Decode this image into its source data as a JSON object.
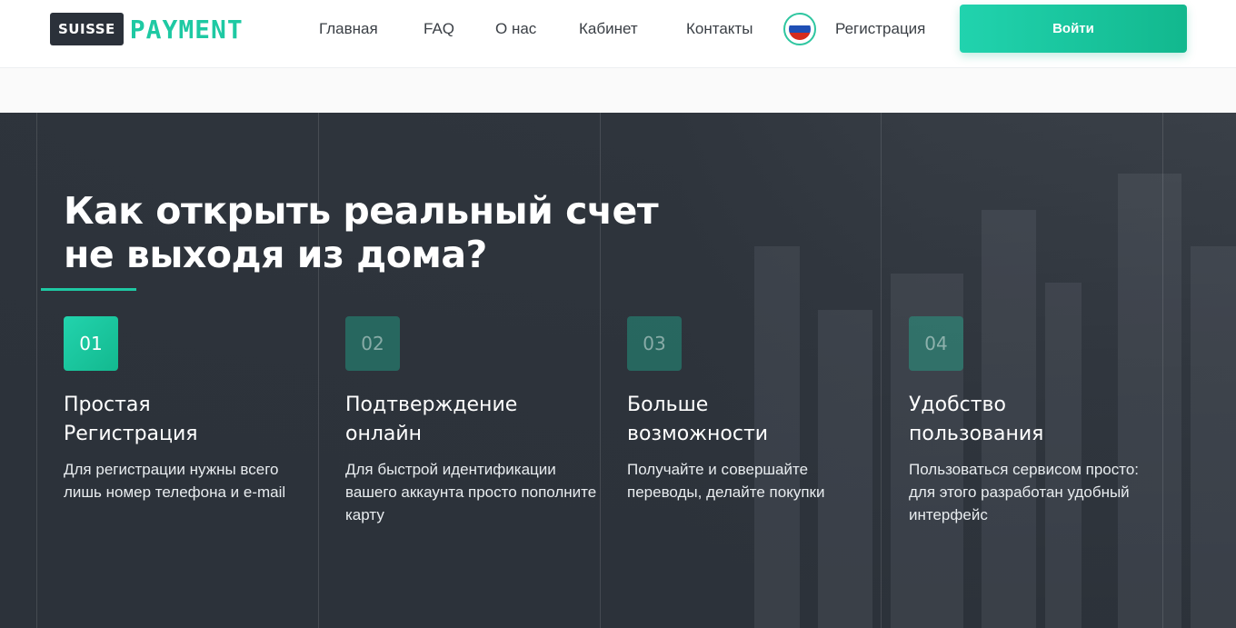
{
  "header": {
    "logo_box": "SUISSE",
    "logo_word": "PAYMENT",
    "nav": [
      "Главная",
      "FAQ",
      "О нас",
      "Кабинет",
      "Контакты",
      "Регистрация"
    ],
    "login_label": "Войти",
    "flag_colors": [
      "#ffffff",
      "#1f4fb5",
      "#d52b1e"
    ],
    "accent_color": "#1ec9a3"
  },
  "hero": {
    "title_line1": "Как открыть реальный счет",
    "title_line2": "не выходя из дома?",
    "steps": [
      {
        "num": "01",
        "title_line1": "Простая",
        "title_line2": "Регистрация",
        "text": "Для регистрации нужны всего лишь номер телефона и e-mail",
        "active": true
      },
      {
        "num": "02",
        "title_line1": "Подтверждение",
        "title_line2": "онлайн",
        "text": "Для быстрой идентификации вашего аккаунта просто пополните карту",
        "active": false
      },
      {
        "num": "03",
        "title_line1": "Больше",
        "title_line2": "возможности",
        "text": "Получайте и совершайте переводы, делайте покупки",
        "active": false
      },
      {
        "num": "04",
        "title_line1": "Удобство",
        "title_line2": "пользования",
        "text": "Пользоваться сервисом просто: для этого разработан удобный интерфейс",
        "active": false
      }
    ]
  }
}
